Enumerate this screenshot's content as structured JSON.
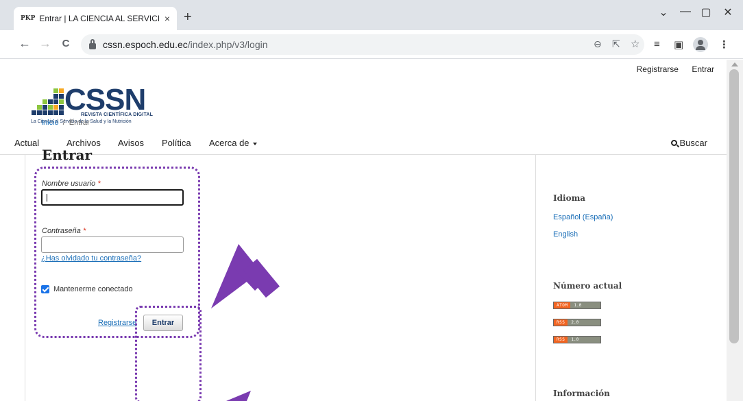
{
  "browser": {
    "tab_favicon": "PKP",
    "tab_title": "Entrar | LA CIENCIA AL SERVICIO",
    "tab_close": "×",
    "new_tab": "+",
    "url_domain": "cssn.espoch.edu.ec",
    "url_path": "/index.php/v3/login",
    "controls": {
      "dropdown": "⌄",
      "minimize": "—",
      "maximize": "▢",
      "close": "✕"
    },
    "nav": {
      "back": "←",
      "forward": "→",
      "reload": "C"
    },
    "icons": [
      "zoom-icon",
      "share-icon",
      "bookmark-star-icon",
      "reading-list-icon",
      "side-panel-icon",
      "profile-icon",
      "menu-icon"
    ]
  },
  "header": {
    "user_links": {
      "register": "Registrarse",
      "login": "Entrar"
    },
    "logo": {
      "text": "CSSN",
      "subtitle": "REVISTA CIENTÍFICA DIGITAL",
      "tagline": "La Ciencia al Servicio de la Salud y la Nutrición"
    },
    "nav": {
      "current": "Actual",
      "archives": "Archivos",
      "notices": "Avisos",
      "policy": "Política",
      "about": "Acerca de",
      "search": "Buscar"
    }
  },
  "breadcrumb": {
    "home": "Inicio",
    "separator": "/",
    "current": "Entrar"
  },
  "login": {
    "title": "Entrar",
    "username_label": "Nombre usuario",
    "password_label": "Contraseña",
    "required_mark": "*",
    "username_value": "",
    "password_value": "",
    "forgot_password": "¿Has olvidado tu contraseña?",
    "remember_label": "Mantenerme conectado",
    "remember_checked": true,
    "register_link": "Registrarse",
    "submit_label": "Entrar"
  },
  "sidebar": {
    "language_heading": "Idioma",
    "languages": [
      "Español (España)",
      "English"
    ],
    "current_issue_heading": "Número actual",
    "feeds": [
      {
        "type": "ATOM",
        "version": "1.0"
      },
      {
        "type": "RSS",
        "version": "2.0"
      },
      {
        "type": "RSS",
        "version": "1.0"
      }
    ],
    "info_heading": "Información"
  },
  "colors": {
    "annotation": "#7a3bb0",
    "link": "#1b6fb8",
    "logo_navy": "#1e3d6b",
    "required": "#d9321c",
    "checkbox": "#1a73e8",
    "feed_orange": "#f26522"
  }
}
